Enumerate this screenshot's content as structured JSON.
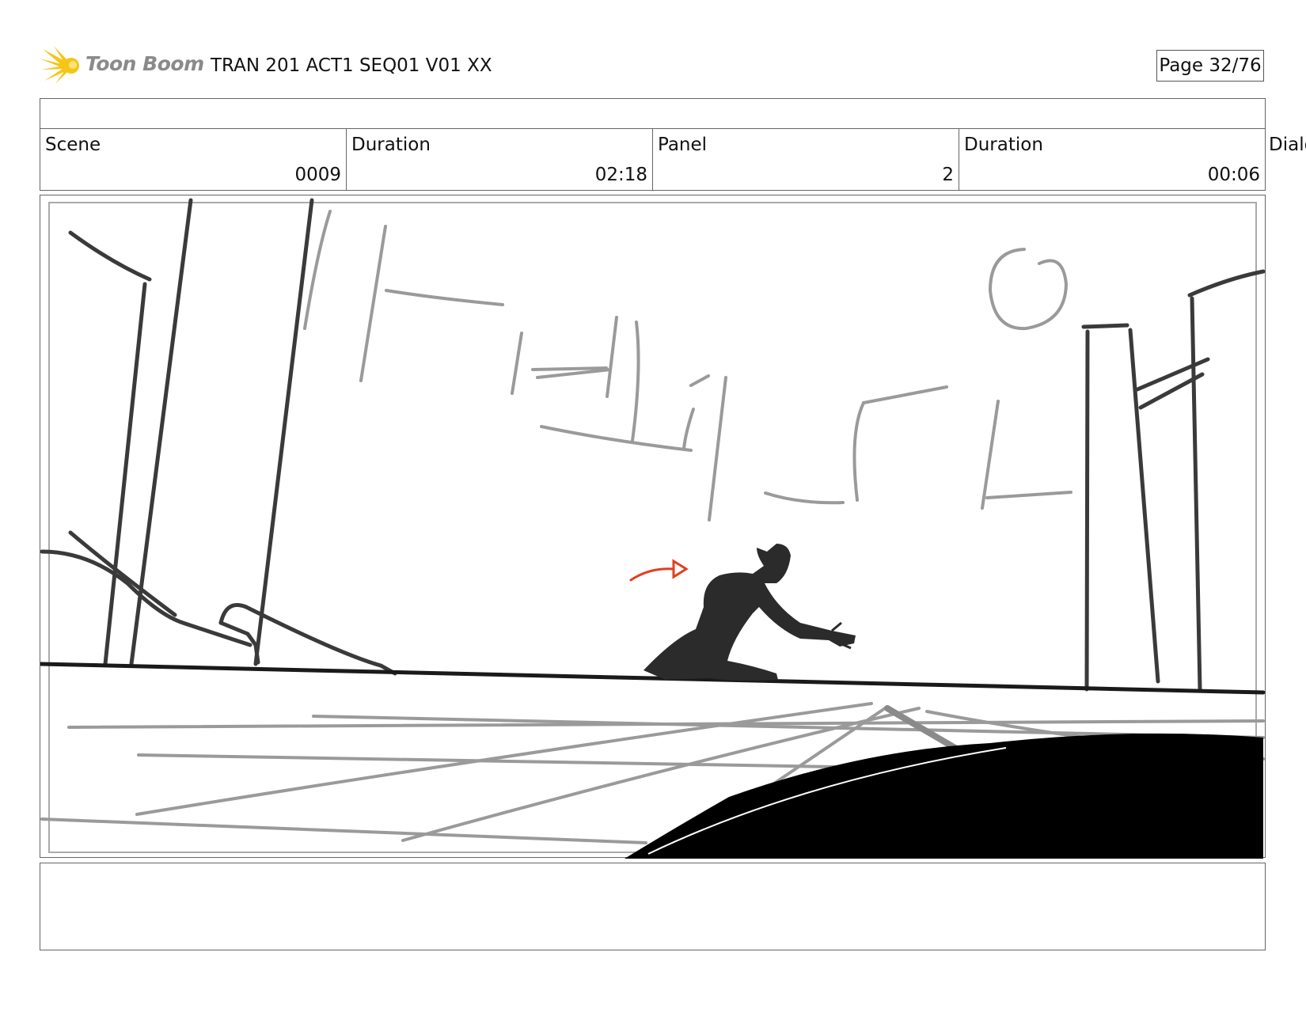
{
  "header": {
    "logo_text": "Toon Boom",
    "title": "TRAN 201 ACT1 SEQ01 V01 XX",
    "page": "Page 32/76"
  },
  "info": {
    "scene_label": "Scene",
    "scene_value": "0009",
    "scene_duration_label": "Duration",
    "scene_duration_value": "02:18",
    "panel_label": "Panel",
    "panel_value": "2",
    "panel_duration_label": "Duration",
    "panel_duration_value": "00:06",
    "dialog_label": "Dialog"
  },
  "icons": {
    "logo": "starburst-logo-icon",
    "camera_move": "arrow-right-icon"
  },
  "colors": {
    "logo_yellow": "#f5c518",
    "arrow_red": "#e0401e"
  }
}
